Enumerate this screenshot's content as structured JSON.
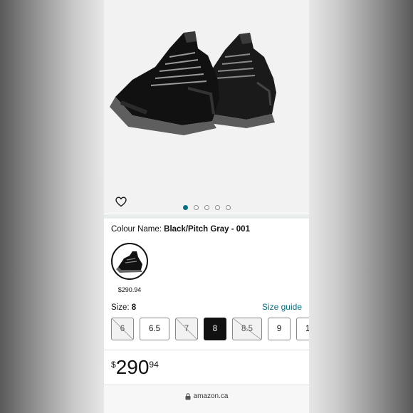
{
  "product": {
    "colour_label": "Colour Name:",
    "colour_value": "Black/Pitch Gray - 001",
    "swatch_price": "$290.94",
    "size_label": "Size:",
    "size_value": "8",
    "size_guide": "Size guide",
    "sizes": [
      {
        "label": "6",
        "state": "unavailable"
      },
      {
        "label": "6.5",
        "state": "available"
      },
      {
        "label": "7",
        "state": "unavailable"
      },
      {
        "label": "8",
        "state": "selected"
      },
      {
        "label": "8.5",
        "state": "unavailable"
      },
      {
        "label": "9",
        "state": "available"
      },
      {
        "label": "1",
        "state": "available"
      }
    ],
    "price": {
      "currency": "$",
      "whole": "290",
      "fraction": "94"
    }
  },
  "gallery": {
    "dot_count": 5,
    "active_index": 0
  },
  "browser": {
    "url": "amazon.ca",
    "lock_icon": "lock-icon"
  },
  "icons": {
    "wishlist": "heart-icon"
  },
  "colors": {
    "accent": "#007185",
    "selected_size": "#111111"
  }
}
